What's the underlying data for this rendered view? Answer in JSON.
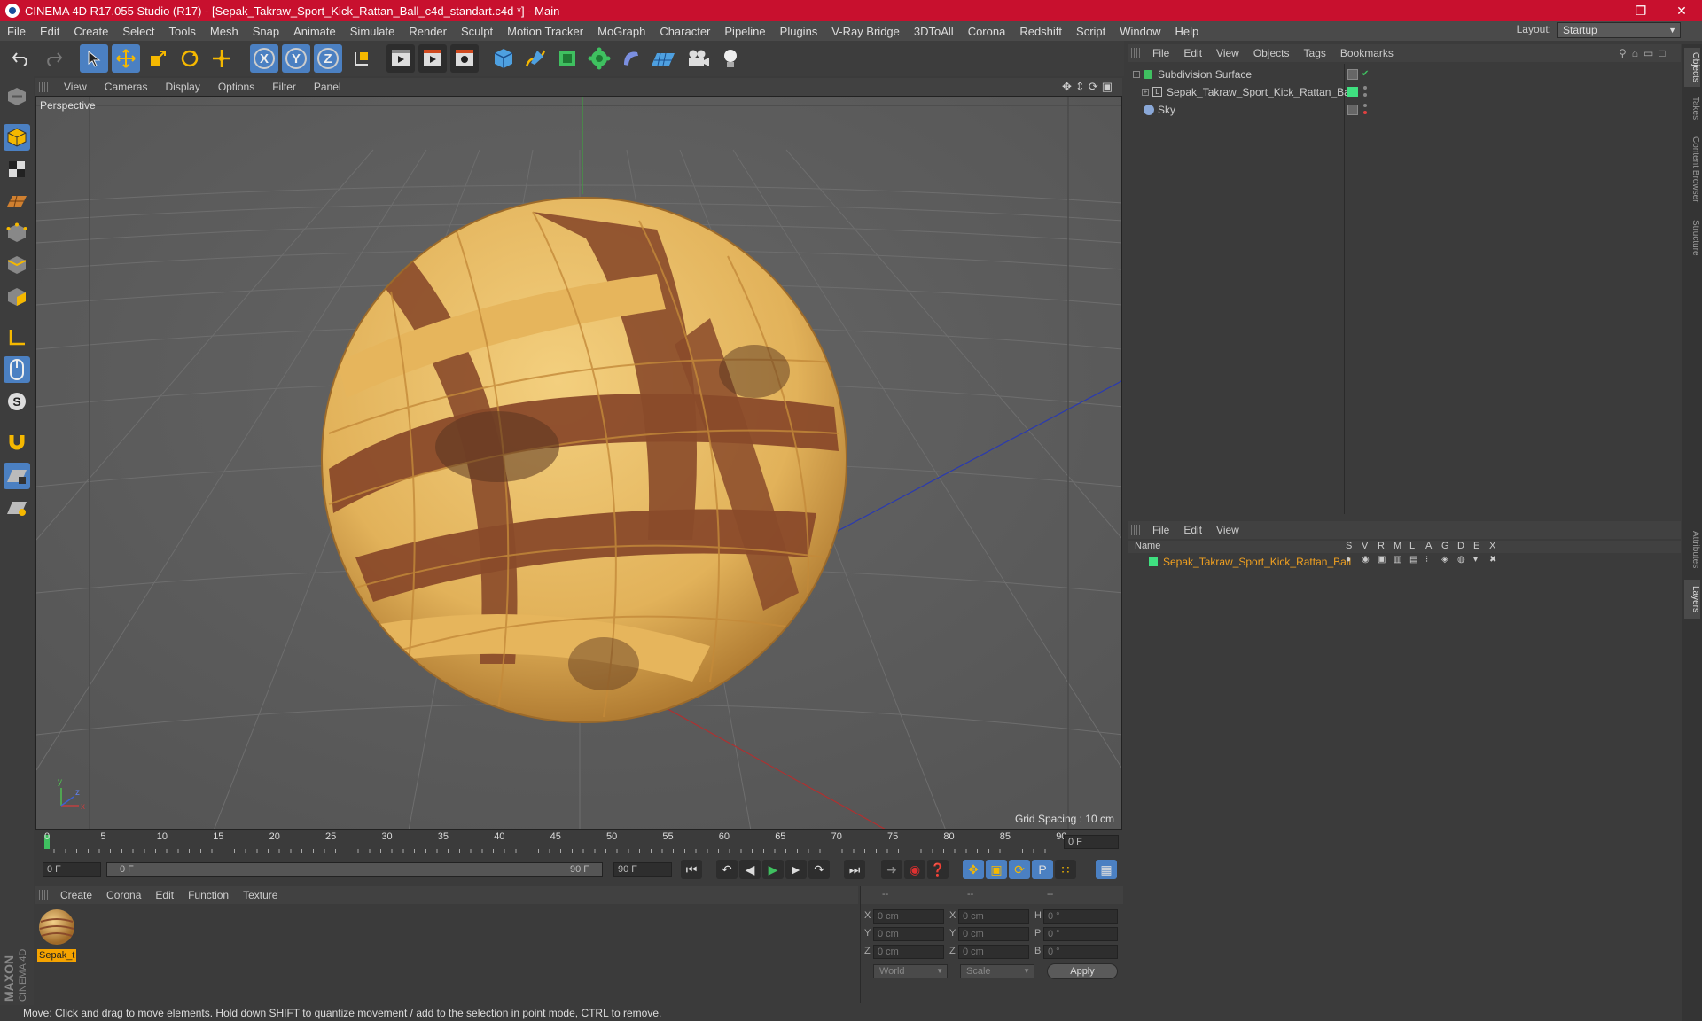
{
  "app": {
    "title": "CINEMA 4D R17.055 Studio (R17) - [Sepak_Takraw_Sport_Kick_Rattan_Ball_c4d_standart.c4d *] - Main"
  },
  "menu": [
    "File",
    "Edit",
    "Create",
    "Select",
    "Tools",
    "Mesh",
    "Snap",
    "Animate",
    "Simulate",
    "Render",
    "Sculpt",
    "Motion Tracker",
    "MoGraph",
    "Character",
    "Pipeline",
    "Plugins",
    "V-Ray Bridge",
    "3DToAll",
    "Corona",
    "Redshift",
    "Script",
    "Window",
    "Help"
  ],
  "layout": {
    "label": "Layout:",
    "value": "Startup"
  },
  "viewport": {
    "menu": [
      "View",
      "Cameras",
      "Display",
      "Options",
      "Filter",
      "Panel"
    ],
    "camera": "Perspective",
    "grid_spacing": "Grid Spacing : 10 cm"
  },
  "timeline": {
    "ticks": [
      "0",
      "5",
      "10",
      "15",
      "20",
      "25",
      "30",
      "35",
      "40",
      "45",
      "50",
      "55",
      "60",
      "65",
      "70",
      "75",
      "80",
      "85",
      "90"
    ],
    "frame_field": "0 F"
  },
  "controls": {
    "start": "0 F",
    "range_start": "0 F",
    "range_end": "90 F",
    "end": "90 F"
  },
  "material": {
    "menu": [
      "Create",
      "Corona",
      "Edit",
      "Function",
      "Texture"
    ],
    "name": "Sepak_t"
  },
  "coords": {
    "headers": [
      "--",
      "--",
      "--"
    ],
    "rows": [
      {
        "a": "X",
        "v1": "0 cm",
        "b": "X",
        "v2": "0 cm",
        "c": "H",
        "v3": "0 °"
      },
      {
        "a": "Y",
        "v1": "0 cm",
        "b": "Y",
        "v2": "0 cm",
        "c": "P",
        "v3": "0 °"
      },
      {
        "a": "Z",
        "v1": "0 cm",
        "b": "Z",
        "v2": "0 cm",
        "c": "B",
        "v3": "0 °"
      }
    ],
    "world": "World",
    "scale": "Scale",
    "apply": "Apply"
  },
  "objects": {
    "menu": [
      "File",
      "Edit",
      "View",
      "Objects",
      "Tags",
      "Bookmarks"
    ],
    "items": [
      {
        "name": "Subdivision Surface"
      },
      {
        "name": "Sepak_Takraw_Sport_Kick_Rattan_Ball"
      },
      {
        "name": "Sky"
      }
    ]
  },
  "layers": {
    "menu": [
      "File",
      "Edit",
      "View"
    ],
    "columns": [
      "Name",
      "S",
      "V",
      "R",
      "M",
      "L",
      "A",
      "G",
      "D",
      "E",
      "X"
    ],
    "item": "Sepak_Takraw_Sport_Kick_Rattan_Ball"
  },
  "status": "Move: Click and drag to move elements. Hold down SHIFT to quantize movement / add to the selection in point mode, CTRL to remove.",
  "side_tabs": [
    "Objects",
    "Takes",
    "Content Browser",
    "Structure",
    "Attributes",
    "Layers"
  ],
  "brand": {
    "maxon": "MAXON",
    "cinema": "CINEMA 4D"
  },
  "colors": {
    "title_bar": "#c8102e",
    "accent": "#4b80c2",
    "ball_light": "#e6b55c",
    "ball_dark": "#8a4a2a",
    "layer_text": "#f0a020"
  }
}
